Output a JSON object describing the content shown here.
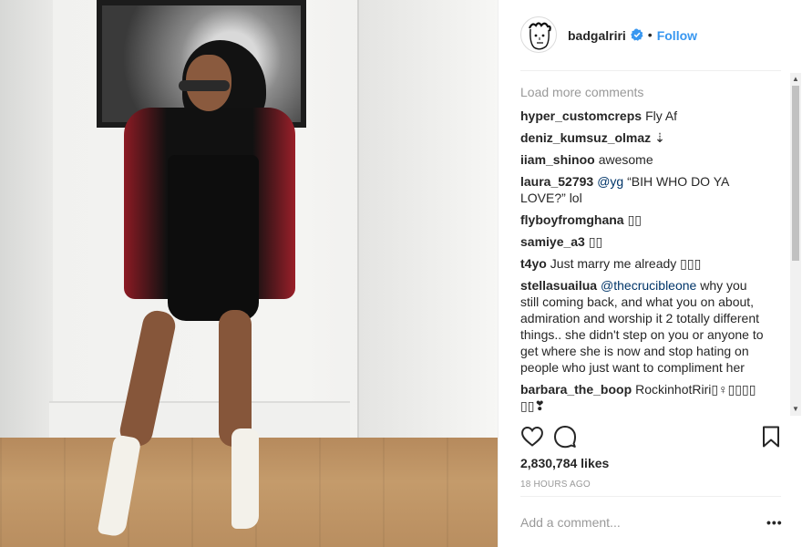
{
  "post": {
    "username": "badgalriri",
    "verified": true,
    "separator": "•",
    "follow_label": "Follow",
    "photo_alt": "Photo of a woman in a black slip dress and red/black jacket standing in a hallway"
  },
  "comments": {
    "load_more": "Load more comments",
    "items": [
      {
        "author": "hyper_customcreps",
        "text": "Fly Af"
      },
      {
        "author": "deniz_kumsuz_olmaz",
        "text": "⇣"
      },
      {
        "author": "iiam_shinoo",
        "text": "awesome"
      },
      {
        "author": "laura_52793",
        "mention": "@yg",
        "text": " “BIH WHO DO YA LOVE?” lol"
      },
      {
        "author": "flyboyfromghana",
        "text": "▯▯"
      },
      {
        "author": "samiye_a3",
        "text": "▯▯"
      },
      {
        "author": "t4yo",
        "text": "Just marry me already ▯▯▯"
      },
      {
        "author": "stellasuailua",
        "mention": "@thecrucibleone",
        "text": " why you still coming back, and what you on about, admiration and worship it 2 totally different things.. she didn't step on you or anyone to get where she is now and stop hating on people who just want to compliment her"
      },
      {
        "author": "barbara_the_boop",
        "text": "RockinhotRiri▯♀▯▯▯▯ ▯▯❣"
      }
    ]
  },
  "actions": {
    "like_icon": "heart-icon",
    "comment_icon": "speech-bubble-icon",
    "save_icon": "bookmark-icon"
  },
  "likes": "2,830,784 likes",
  "timestamp": "18 HOURS AGO",
  "add_comment": {
    "placeholder": "Add a comment...",
    "more_label": "•••"
  },
  "colors": {
    "link_blue": "#3897f0",
    "mention_blue": "#003569",
    "muted": "#999999",
    "text": "#262626"
  }
}
